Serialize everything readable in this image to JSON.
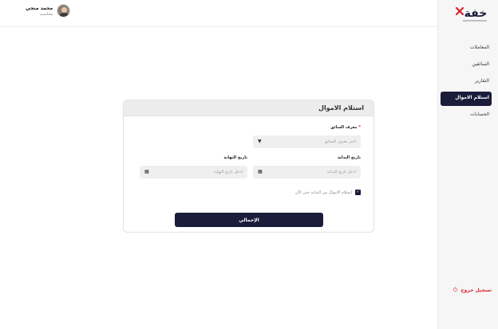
{
  "brand": {
    "name": "خفة",
    "accent": "#d9232a",
    "primary": "#1b1b3a"
  },
  "user": {
    "name": "محمد منجي",
    "role": "محاسب"
  },
  "sidebar": {
    "items": [
      {
        "label": "المعاملات",
        "active": false
      },
      {
        "label": "السائقين",
        "active": false
      },
      {
        "label": "التقارير",
        "active": false
      },
      {
        "label": "استلام الاموال",
        "active": true
      },
      {
        "label": "الحسابات",
        "active": false
      }
    ],
    "logout_label": "تسجيل خروج",
    "logout_icon": "logout-icon"
  },
  "form": {
    "title": "استلام الاموال",
    "driver": {
      "required_mark": "*",
      "label": "معرف السائق",
      "placeholder": "اختر معرف السائق",
      "icon": "caret-down-icon"
    },
    "start_date": {
      "label": "تاريخ البداية",
      "placeholder": "ادخل تاريخ البداية",
      "icon": "calendar-icon"
    },
    "end_date": {
      "label": "تاريخ النهاية",
      "placeholder": "ادخل تاريخ النهاية",
      "icon": "calendar-icon"
    },
    "checkbox": {
      "label": "استلام الاموال من البداية حتى الآن",
      "checked": true
    },
    "submit_label": "الإجمالي"
  }
}
